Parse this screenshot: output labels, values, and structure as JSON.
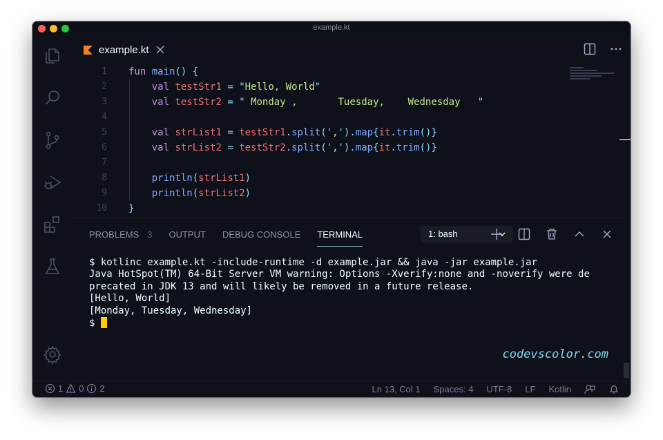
{
  "window": {
    "title": "example.kt"
  },
  "activity_bar": {
    "items": [
      "files-icon",
      "search-icon",
      "source-control-icon",
      "run-debug-icon",
      "extensions-icon",
      "testing-icon"
    ],
    "bottom": "settings-gear-icon"
  },
  "tab": {
    "label": "example.kt",
    "icon": "kotlin-icon"
  },
  "editor": {
    "line_numbers": [
      "1",
      "2",
      "3",
      "4",
      "5",
      "6",
      "7",
      "8",
      "9",
      "10"
    ],
    "lines": [
      [
        [
          "kw",
          "fun"
        ],
        [
          "pl",
          " "
        ],
        [
          "fn",
          "main"
        ],
        [
          "op",
          "() {"
        ]
      ],
      [
        [
          "pl",
          "    "
        ],
        [
          "kw",
          "val"
        ],
        [
          "pl",
          " "
        ],
        [
          "id",
          "testStr1"
        ],
        [
          "pl",
          " "
        ],
        [
          "op",
          "="
        ],
        [
          "pl",
          " "
        ],
        [
          "op",
          "\""
        ],
        [
          "str",
          "Hello, World"
        ],
        [
          "op",
          "\""
        ]
      ],
      [
        [
          "pl",
          "    "
        ],
        [
          "kw",
          "val"
        ],
        [
          "pl",
          " "
        ],
        [
          "id",
          "testStr2"
        ],
        [
          "pl",
          " "
        ],
        [
          "op",
          "="
        ],
        [
          "pl",
          " "
        ],
        [
          "op",
          "\""
        ],
        [
          "str",
          " Monday ,       Tuesday,    Wednesday   "
        ],
        [
          "op",
          "\""
        ]
      ],
      [],
      [
        [
          "pl",
          "    "
        ],
        [
          "kw",
          "val"
        ],
        [
          "pl",
          " "
        ],
        [
          "id",
          "strList1"
        ],
        [
          "pl",
          " "
        ],
        [
          "op",
          "="
        ],
        [
          "pl",
          " "
        ],
        [
          "id",
          "testStr1"
        ],
        [
          "op",
          "."
        ],
        [
          "fn",
          "split"
        ],
        [
          "op",
          "('"
        ],
        [
          "str",
          ","
        ],
        [
          "op",
          "')."
        ],
        [
          "fn",
          "map"
        ],
        [
          "op",
          "{"
        ],
        [
          "id",
          "it"
        ],
        [
          "op",
          "."
        ],
        [
          "fn",
          "trim"
        ],
        [
          "op",
          "()}"
        ]
      ],
      [
        [
          "pl",
          "    "
        ],
        [
          "kw",
          "val"
        ],
        [
          "pl",
          " "
        ],
        [
          "id",
          "strList2"
        ],
        [
          "pl",
          " "
        ],
        [
          "op",
          "="
        ],
        [
          "pl",
          " "
        ],
        [
          "id",
          "testStr2"
        ],
        [
          "op",
          "."
        ],
        [
          "fn",
          "split"
        ],
        [
          "op",
          "('"
        ],
        [
          "str",
          ","
        ],
        [
          "op",
          "')."
        ],
        [
          "fn",
          "map"
        ],
        [
          "op",
          "{"
        ],
        [
          "id",
          "it"
        ],
        [
          "op",
          "."
        ],
        [
          "fn",
          "trim"
        ],
        [
          "op",
          "()}"
        ]
      ],
      [],
      [
        [
          "pl",
          "    "
        ],
        [
          "fn",
          "println"
        ],
        [
          "op",
          "("
        ],
        [
          "id",
          "strList1"
        ],
        [
          "op",
          ")"
        ]
      ],
      [
        [
          "pl",
          "    "
        ],
        [
          "fn",
          "println"
        ],
        [
          "op",
          "("
        ],
        [
          "id",
          "strList2"
        ],
        [
          "op",
          ")"
        ]
      ],
      [
        [
          "op",
          "}"
        ]
      ]
    ]
  },
  "panel": {
    "tabs": {
      "problems": "PROBLEMS",
      "problems_count": "3",
      "output": "OUTPUT",
      "debug_console": "DEBUG CONSOLE",
      "terminal": "TERMINAL"
    },
    "terminal_select": "1: bash",
    "terminal_lines": [
      "$ kotlinc example.kt -include-runtime -d example.jar && java -jar example.jar",
      "Java HotSpot(TM) 64-Bit Server VM warning: Options -Xverify:none and -noverify were de",
      "precated in JDK 13 and will likely be removed in a future release.",
      "[Hello, World]",
      "[Monday, Tuesday, Wednesday]"
    ],
    "prompt": "$ ",
    "watermark": "codevscolor.com"
  },
  "status_bar": {
    "errors": "1",
    "warnings": "0",
    "infos": "2",
    "position": "Ln 13, Col 1",
    "spaces": "Spaces: 4",
    "encoding": "UTF-8",
    "eol": "LF",
    "language": "Kotlin"
  },
  "colors": {
    "background": "#0f111a",
    "keyword": "#c792ea",
    "function": "#82aaff",
    "string": "#c3e88d",
    "operator": "#89ddff",
    "identifier": "#f07178",
    "cursor": "#ffcc00",
    "accent": "#80cbc4"
  }
}
